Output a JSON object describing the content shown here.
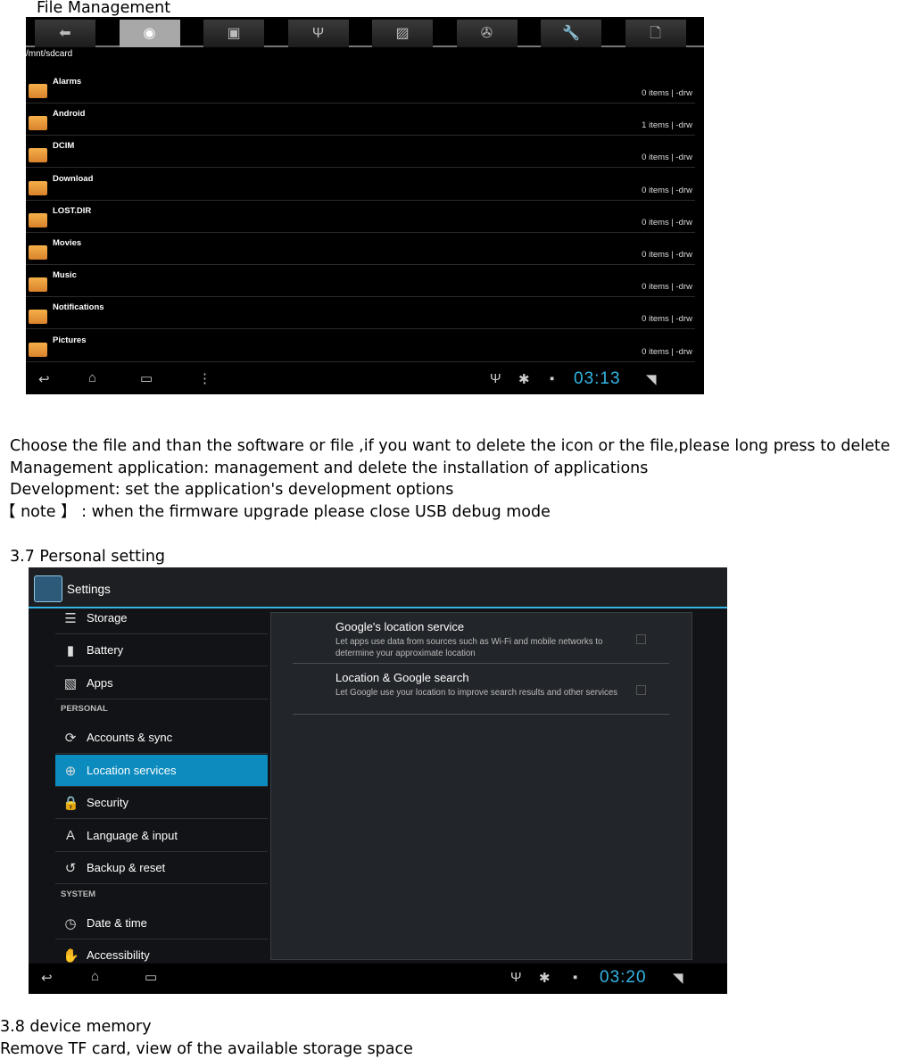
{
  "doc": {
    "title": "File Management",
    "para": [
      "Choose the file and than the software or file ,if you want to delete the icon or the file,please long press to delete",
      "Management application: management and delete the installation of applications",
      "Development: set the application's development options",
      "【  note  】  : when the firmware upgrade please close USB debug mode"
    ],
    "sec37": "3.7 Personal setting",
    "sec38": "3.8 device memory",
    "sec38_text": "Remove TF card, view of the available storage space"
  },
  "file_manager": {
    "tabs": [
      {
        "icon": "back-arrow-icon",
        "glyph": "⬅"
      },
      {
        "icon": "sdcard-icon",
        "glyph": "◉",
        "active": true
      },
      {
        "icon": "internal-storage-icon",
        "glyph": "▣"
      },
      {
        "icon": "usb-icon",
        "glyph": "Ψ"
      },
      {
        "icon": "image-icon",
        "glyph": "▨"
      },
      {
        "icon": "film-reel-icon",
        "glyph": "✇"
      },
      {
        "icon": "wrench-icon",
        "glyph": "🔧"
      },
      {
        "icon": "document-icon",
        "glyph": "🗋"
      }
    ],
    "path": "/mnt/sdcard",
    "folders": [
      {
        "name": "Alarms",
        "meta": "0 items | -drw"
      },
      {
        "name": "Android",
        "meta": "1 items | -drw"
      },
      {
        "name": "DCIM",
        "meta": "0 items | -drw"
      },
      {
        "name": "Download",
        "meta": "0 items | -drw"
      },
      {
        "name": "LOST.DIR",
        "meta": "0 items | -drw"
      },
      {
        "name": "Movies",
        "meta": "0 items | -drw"
      },
      {
        "name": "Music",
        "meta": "0 items | -drw"
      },
      {
        "name": "Notifications",
        "meta": "0 items | -drw"
      },
      {
        "name": "Pictures",
        "meta": "0 items | -drw"
      }
    ],
    "clock": "03:13"
  },
  "settings": {
    "title": "Settings",
    "items": [
      {
        "label": "Storage",
        "icon": "storage-icon",
        "glyph": "☰"
      },
      {
        "label": "Battery",
        "icon": "battery-icon",
        "glyph": "▮"
      },
      {
        "label": "Apps",
        "icon": "apps-icon",
        "glyph": "▧"
      },
      {
        "label": "Accounts & sync",
        "icon": "sync-icon",
        "glyph": "⟳"
      },
      {
        "label": "Location services",
        "icon": "location-icon",
        "glyph": "⊕",
        "selected": true
      },
      {
        "label": "Security",
        "icon": "lock-icon",
        "glyph": "🔒"
      },
      {
        "label": "Language & input",
        "icon": "language-icon",
        "glyph": "A"
      },
      {
        "label": "Backup & reset",
        "icon": "backup-icon",
        "glyph": "↺"
      },
      {
        "label": "Date & time",
        "icon": "clock-icon",
        "glyph": "◷"
      },
      {
        "label": "Accessibility",
        "icon": "hand-icon",
        "glyph": "✋"
      }
    ],
    "sections": [
      "PERSONAL",
      "SYSTEM"
    ],
    "options": [
      {
        "title": "Google's location service",
        "desc": "Let apps use data from sources such as Wi-Fi and mobile networks to determine your approximate location",
        "checked": false
      },
      {
        "title": "Location & Google search",
        "desc": "Let Google use your location to improve search results and other services",
        "checked": false
      }
    ],
    "clock": "03:20",
    "accent": "#33b5e5"
  },
  "navbar": {
    "back": "↩",
    "home": "⌂",
    "recent": "▭",
    "menu": "⋮",
    "usb": "Ψ",
    "debug": "✱",
    "notif": "▪",
    "wifi": "◥"
  }
}
